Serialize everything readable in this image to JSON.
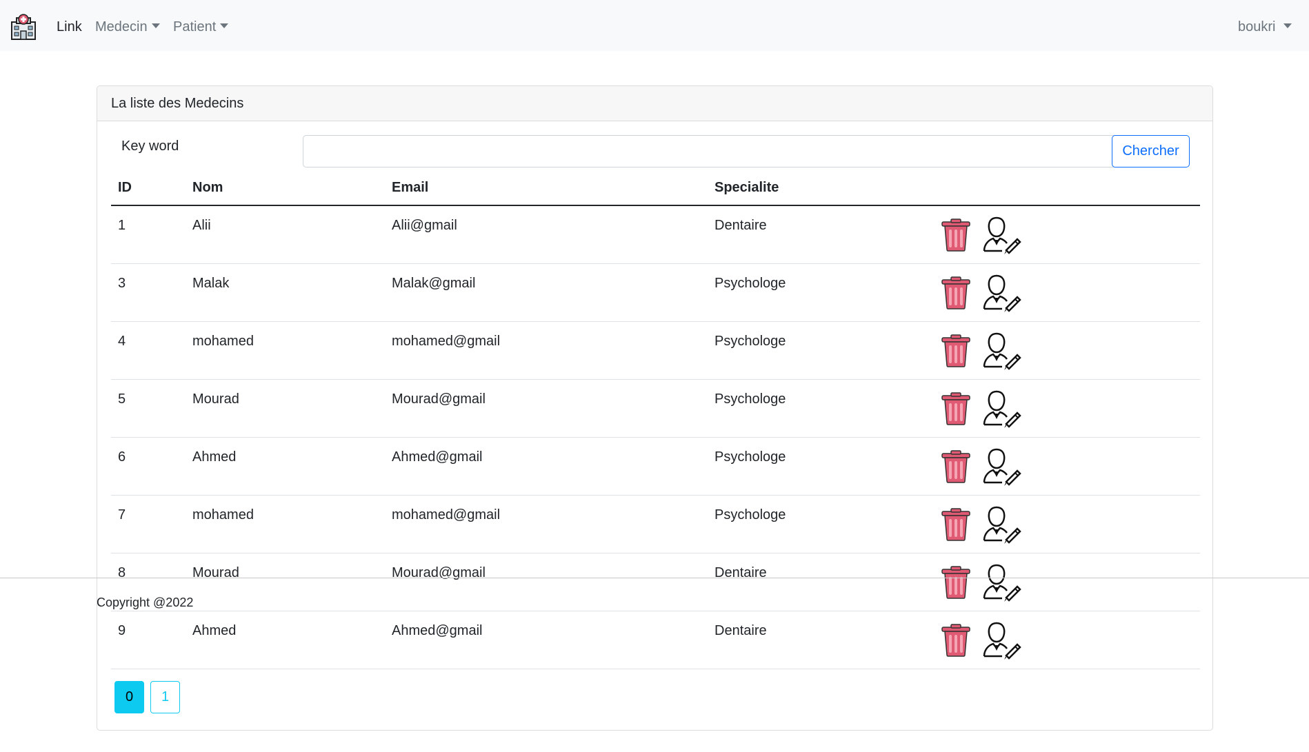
{
  "navbar": {
    "brand_icon": "hospital-icon",
    "links": [
      {
        "label": "Link"
      },
      {
        "label": "Medecin"
      },
      {
        "label": "Patient"
      }
    ],
    "user": "boukri"
  },
  "card": {
    "title": "La liste des Medecins",
    "search": {
      "label": "Key word",
      "value": "",
      "button_label": "Chercher"
    },
    "table": {
      "headers": {
        "id": "ID",
        "nom": "Nom",
        "email": "Email",
        "specialite": "Specialite"
      },
      "rows": [
        {
          "id": "1",
          "nom": "Alii",
          "email": "Alii@gmail",
          "specialite": "Dentaire"
        },
        {
          "id": "3",
          "nom": "Malak",
          "email": "Malak@gmail",
          "specialite": "Psychologe"
        },
        {
          "id": "4",
          "nom": "mohamed",
          "email": "mohamed@gmail",
          "specialite": "Psychologe"
        },
        {
          "id": "5",
          "nom": "Mourad",
          "email": "Mourad@gmail",
          "specialite": "Psychologe"
        },
        {
          "id": "6",
          "nom": "Ahmed",
          "email": "Ahmed@gmail",
          "specialite": "Psychologe"
        },
        {
          "id": "7",
          "nom": "mohamed",
          "email": "mohamed@gmail",
          "specialite": "Psychologe"
        },
        {
          "id": "8",
          "nom": "Mourad",
          "email": "Mourad@gmail",
          "specialite": "Dentaire"
        },
        {
          "id": "9",
          "nom": "Ahmed",
          "email": "Ahmed@gmail",
          "specialite": "Dentaire"
        }
      ],
      "row_actions": [
        "trash-icon",
        "edit-user-icon"
      ]
    },
    "pagination": {
      "pages": [
        "0",
        "1"
      ],
      "active_page": "0"
    }
  },
  "footer": {
    "text": "Copyright @2022"
  },
  "colors": {
    "navbar_bg": "#f8f9fa",
    "primary": "#0d6efd",
    "info": "#0dcaf0",
    "trash": "#e05a73"
  }
}
